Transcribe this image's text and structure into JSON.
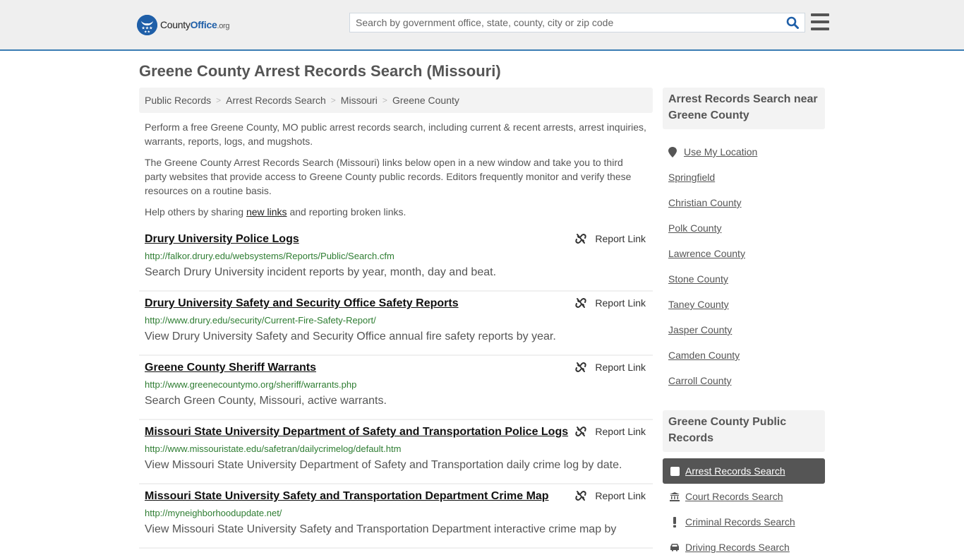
{
  "header": {
    "logo": {
      "prefix": "County",
      "brand": "Office",
      "suffix": ".org"
    },
    "search": {
      "placeholder": "Search by government office, state, county, city or zip code",
      "value": ""
    },
    "icons": {
      "search": "search-icon",
      "menu": "hamburger-menu-icon"
    }
  },
  "page": {
    "title": "Greene County Arrest Records Search (Missouri)"
  },
  "breadcrumb": [
    {
      "label": "Public Records"
    },
    {
      "label": "Arrest Records Search"
    },
    {
      "label": "Missouri"
    },
    {
      "label": "Greene County"
    }
  ],
  "breadcrumb_separator": ">",
  "intro": {
    "p1": "Perform a free Greene County, MO public arrest records search, including current & recent arrests, arrest inquiries, warrants, reports, logs, and mugshots.",
    "p2": "The Greene County Arrest Records Search (Missouri) links below open in a new window and take you to third party websites that provide access to Greene County public records. Editors frequently monitor and verify these resources on a routine basis.",
    "p3_before": "Help others by sharing ",
    "p3_link": "new links",
    "p3_after": " and reporting broken links."
  },
  "report_link_label": "Report Link",
  "results": [
    {
      "title": "Drury University Police Logs",
      "url": "http://falkor.drury.edu/websystems/Reports/Public/Search.cfm",
      "description": "Search Drury University incident reports by year, month, day and beat."
    },
    {
      "title": "Drury University Safety and Security Office Safety Reports",
      "url": "http://www.drury.edu/security/Current-Fire-Safety-Report/",
      "description": "View Drury University Safety and Security Office annual fire safety reports by year."
    },
    {
      "title": "Greene County Sheriff Warrants",
      "url": "http://www.greenecountymo.org/sheriff/warrants.php",
      "description": "Search Green County, Missouri, active warrants."
    },
    {
      "title": "Missouri State University Department of Safety and Transportation Police Logs",
      "url": "http://www.missouristate.edu/safetran/dailycrimelog/default.htm",
      "description": "View Missouri State University Department of Safety and Transportation daily crime log by date."
    },
    {
      "title": "Missouri State University Safety and Transportation Department Crime Map",
      "url": "http://myneighborhoodupdate.net/",
      "description": "View Missouri State University Safety and Transportation Department interactive crime map by"
    }
  ],
  "sidebar": {
    "nearby": {
      "heading": "Arrest Records Search near Greene County",
      "use_location": "Use My Location",
      "links": [
        "Springfield",
        "Christian County",
        "Polk County",
        "Lawrence County",
        "Stone County",
        "Taney County",
        "Jasper County",
        "Camden County",
        "Carroll County"
      ]
    },
    "public_records": {
      "heading": "Greene County Public Records",
      "items": [
        {
          "label": "Arrest Records Search",
          "icon": "square-icon",
          "active": true
        },
        {
          "label": "Court Records Search",
          "icon": "courthouse-icon",
          "active": false
        },
        {
          "label": "Criminal Records Search",
          "icon": "exclamation-icon",
          "active": false
        },
        {
          "label": "Driving Records Search",
          "icon": "car-icon",
          "active": false
        }
      ]
    }
  },
  "colors": {
    "brand_blue": "#1f5fa8",
    "header_border": "#3a7db3",
    "url_green": "#2e7d32",
    "active_nav_bg": "#555555"
  }
}
